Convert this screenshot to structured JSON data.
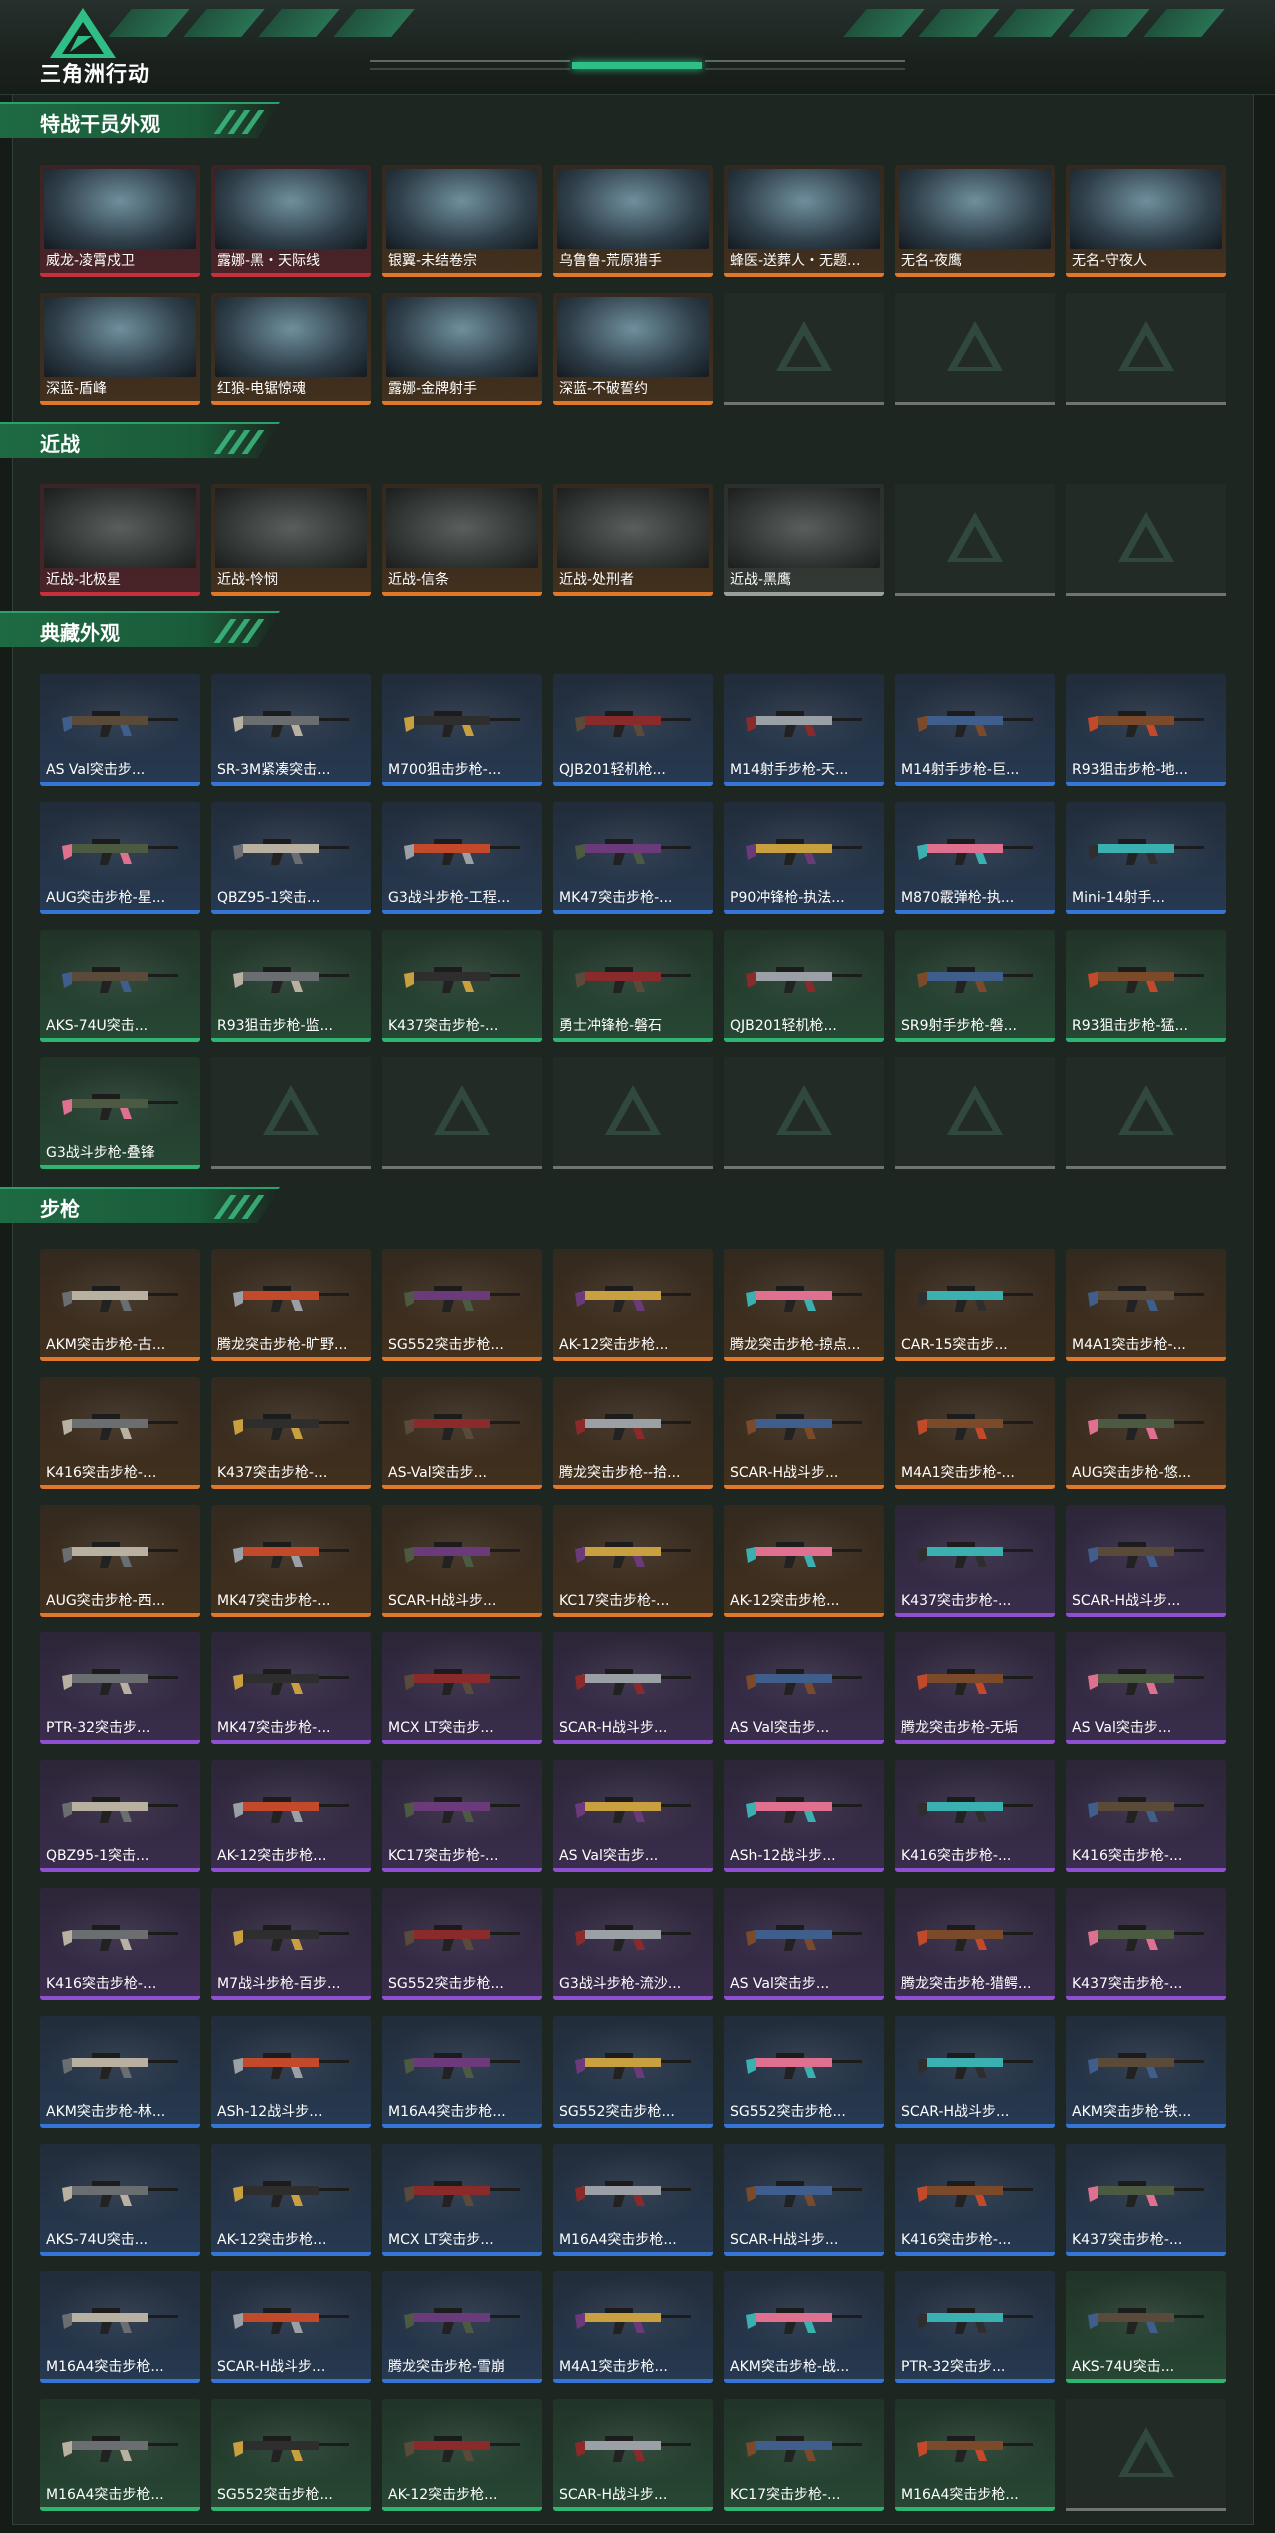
{
  "header": {
    "brand": "三角洲行动",
    "logo_icon": "delta-triangle-logo-icon"
  },
  "colors": {
    "accent": "#2fbf86",
    "rarity_red": "#c5303a",
    "rarity_orange": "#e0782a",
    "rarity_purple": "#8e4fd1",
    "rarity_blue": "#3475d6",
    "rarity_green": "#2fb572",
    "rarity_gray": "#9aa09b"
  },
  "sections": [
    {
      "title": "特战干员外观",
      "kind": "char",
      "slots": 14,
      "items": [
        {
          "label": "威龙-凌霄戍卫",
          "rarity": "red"
        },
        {
          "label": "露娜-黑・天际线",
          "rarity": "red"
        },
        {
          "label": "银翼-未结卷宗",
          "rarity": "orange"
        },
        {
          "label": "乌鲁鲁-荒原猎手",
          "rarity": "orange"
        },
        {
          "label": "蜂医-送葬人・无题...",
          "rarity": "orange"
        },
        {
          "label": "无名-夜鹰",
          "rarity": "orange"
        },
        {
          "label": "无名-守夜人",
          "rarity": "orange"
        },
        {
          "label": "深蓝-盾峰",
          "rarity": "orange"
        },
        {
          "label": "红狼-电锯惊魂",
          "rarity": "orange"
        },
        {
          "label": "露娜-金牌射手",
          "rarity": "orange"
        },
        {
          "label": "深蓝-不破誓约",
          "rarity": "orange"
        }
      ]
    },
    {
      "title": "近战",
      "kind": "knife",
      "slots": 7,
      "items": [
        {
          "label": "近战-北极星",
          "rarity": "red"
        },
        {
          "label": "近战-怜悯",
          "rarity": "orange"
        },
        {
          "label": "近战-信条",
          "rarity": "orange"
        },
        {
          "label": "近战-处刑者",
          "rarity": "orange"
        },
        {
          "label": "近战-黑鹰",
          "rarity": "gray"
        }
      ]
    },
    {
      "title": "典藏外观",
      "kind": "gun",
      "slots": 28,
      "items": [
        {
          "label": "AS Val突击步...",
          "rarity": "blue"
        },
        {
          "label": "SR-3M紧凑突击...",
          "rarity": "blue"
        },
        {
          "label": "M700狙击步枪-...",
          "rarity": "blue"
        },
        {
          "label": "QJB201轻机枪...",
          "rarity": "blue"
        },
        {
          "label": "M14射手步枪-天...",
          "rarity": "blue"
        },
        {
          "label": "M14射手步枪-巨...",
          "rarity": "blue"
        },
        {
          "label": "R93狙击步枪-地...",
          "rarity": "blue"
        },
        {
          "label": "AUG突击步枪-星...",
          "rarity": "blue"
        },
        {
          "label": "QBZ95-1突击...",
          "rarity": "blue"
        },
        {
          "label": "G3战斗步枪-工程...",
          "rarity": "blue"
        },
        {
          "label": "MK47突击步枪-...",
          "rarity": "blue"
        },
        {
          "label": "P90冲锋枪-执法...",
          "rarity": "blue"
        },
        {
          "label": "M870霰弹枪-执...",
          "rarity": "blue"
        },
        {
          "label": "Mini-14射手...",
          "rarity": "blue"
        },
        {
          "label": "AKS-74U突击...",
          "rarity": "green"
        },
        {
          "label": "R93狙击步枪-监...",
          "rarity": "green"
        },
        {
          "label": "K437突击步枪-...",
          "rarity": "green"
        },
        {
          "label": "勇士冲锋枪-磐石",
          "rarity": "green"
        },
        {
          "label": "QJB201轻机枪...",
          "rarity": "green"
        },
        {
          "label": "SR9射手步枪-磐...",
          "rarity": "green"
        },
        {
          "label": "R93狙击步枪-猛...",
          "rarity": "green"
        },
        {
          "label": "G3战斗步枪-叠锋",
          "rarity": "green"
        }
      ]
    },
    {
      "title": "步枪",
      "kind": "gun",
      "slots": 70,
      "items": [
        {
          "label": "AKM突击步枪-古...",
          "rarity": "orange"
        },
        {
          "label": "腾龙突击步枪-旷野...",
          "rarity": "orange"
        },
        {
          "label": "SG552突击步枪...",
          "rarity": "orange"
        },
        {
          "label": "AK-12突击步枪...",
          "rarity": "orange"
        },
        {
          "label": "腾龙突击步枪-掠点...",
          "rarity": "orange"
        },
        {
          "label": "CAR-15突击步...",
          "rarity": "orange"
        },
        {
          "label": "M4A1突击步枪-...",
          "rarity": "orange"
        },
        {
          "label": "K416突击步枪-...",
          "rarity": "orange"
        },
        {
          "label": "K437突击步枪-...",
          "rarity": "orange"
        },
        {
          "label": "AS-Val突击步...",
          "rarity": "orange"
        },
        {
          "label": "腾龙突击步枪--拾...",
          "rarity": "orange"
        },
        {
          "label": "SCAR-H战斗步...",
          "rarity": "orange"
        },
        {
          "label": "M4A1突击步枪-...",
          "rarity": "orange"
        },
        {
          "label": "AUG突击步枪-悠...",
          "rarity": "orange"
        },
        {
          "label": "AUG突击步枪-西...",
          "rarity": "orange"
        },
        {
          "label": "MK47突击步枪-...",
          "rarity": "orange"
        },
        {
          "label": "SCAR-H战斗步...",
          "rarity": "orange"
        },
        {
          "label": "KC17突击步枪-...",
          "rarity": "orange"
        },
        {
          "label": "AK-12突击步枪...",
          "rarity": "orange"
        },
        {
          "label": "K437突击步枪-...",
          "rarity": "purple"
        },
        {
          "label": "SCAR-H战斗步...",
          "rarity": "purple"
        },
        {
          "label": "PTR-32突击步...",
          "rarity": "purple"
        },
        {
          "label": "MK47突击步枪-...",
          "rarity": "purple"
        },
        {
          "label": "MCX LT突击步...",
          "rarity": "purple"
        },
        {
          "label": "SCAR-H战斗步...",
          "rarity": "purple"
        },
        {
          "label": "AS Val突击步...",
          "rarity": "purple"
        },
        {
          "label": "腾龙突击步枪-无垢",
          "rarity": "purple"
        },
        {
          "label": "AS Val突击步...",
          "rarity": "purple"
        },
        {
          "label": "QBZ95-1突击...",
          "rarity": "purple"
        },
        {
          "label": "AK-12突击步枪...",
          "rarity": "purple"
        },
        {
          "label": "KC17突击步枪-...",
          "rarity": "purple"
        },
        {
          "label": "AS Val突击步...",
          "rarity": "purple"
        },
        {
          "label": "ASh-12战斗步...",
          "rarity": "purple"
        },
        {
          "label": "K416突击步枪-...",
          "rarity": "purple"
        },
        {
          "label": "K416突击步枪-...",
          "rarity": "purple"
        },
        {
          "label": "K416突击步枪-...",
          "rarity": "purple"
        },
        {
          "label": "M7战斗步枪-百步...",
          "rarity": "purple"
        },
        {
          "label": "SG552突击步枪...",
          "rarity": "purple"
        },
        {
          "label": "G3战斗步枪-流沙...",
          "rarity": "purple"
        },
        {
          "label": "AS Val突击步...",
          "rarity": "purple"
        },
        {
          "label": "腾龙突击步枪-猎鳄...",
          "rarity": "purple"
        },
        {
          "label": "K437突击步枪-...",
          "rarity": "purple"
        },
        {
          "label": "AKM突击步枪-林...",
          "rarity": "blue"
        },
        {
          "label": "ASh-12战斗步...",
          "rarity": "blue"
        },
        {
          "label": "M16A4突击步枪...",
          "rarity": "blue"
        },
        {
          "label": "SG552突击步枪...",
          "rarity": "blue"
        },
        {
          "label": "SG552突击步枪...",
          "rarity": "blue"
        },
        {
          "label": "SCAR-H战斗步...",
          "rarity": "blue"
        },
        {
          "label": "AKM突击步枪-铁...",
          "rarity": "blue"
        },
        {
          "label": "AKS-74U突击...",
          "rarity": "blue"
        },
        {
          "label": "AK-12突击步枪...",
          "rarity": "blue"
        },
        {
          "label": "MCX LT突击步...",
          "rarity": "blue"
        },
        {
          "label": "M16A4突击步枪...",
          "rarity": "blue"
        },
        {
          "label": "SCAR-H战斗步...",
          "rarity": "blue"
        },
        {
          "label": "K416突击步枪-...",
          "rarity": "blue"
        },
        {
          "label": "K437突击步枪-...",
          "rarity": "blue"
        },
        {
          "label": "M16A4突击步枪...",
          "rarity": "blue"
        },
        {
          "label": "SCAR-H战斗步...",
          "rarity": "blue"
        },
        {
          "label": "腾龙突击步枪-雪崩",
          "rarity": "blue"
        },
        {
          "label": "M4A1突击步枪...",
          "rarity": "blue"
        },
        {
          "label": "AKM突击步枪-战...",
          "rarity": "blue"
        },
        {
          "label": "PTR-32突击步...",
          "rarity": "blue"
        },
        {
          "label": "AKS-74U突击...",
          "rarity": "green"
        },
        {
          "label": "M16A4突击步枪...",
          "rarity": "green"
        },
        {
          "label": "SG552突击步枪...",
          "rarity": "green"
        },
        {
          "label": "AK-12突击步枪...",
          "rarity": "green"
        },
        {
          "label": "SCAR-H战斗步...",
          "rarity": "green"
        },
        {
          "label": "KC17突击步枪-...",
          "rarity": "green"
        },
        {
          "label": "M16A4突击步枪...",
          "rarity": "green"
        }
      ]
    }
  ]
}
